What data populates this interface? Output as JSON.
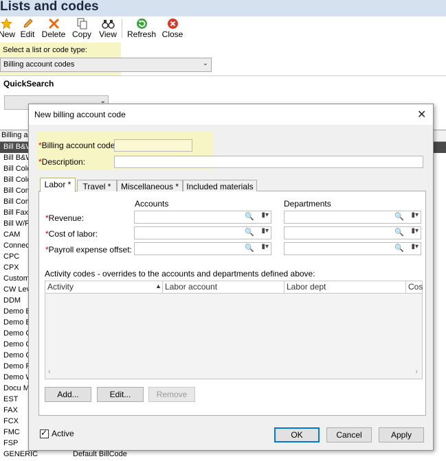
{
  "window": {
    "title": "Lists and codes"
  },
  "toolbar": {
    "buttons": [
      {
        "label": "New",
        "icon": "star-icon"
      },
      {
        "label": "Edit",
        "icon": "pencil-icon"
      },
      {
        "label": "Delete",
        "icon": "x-icon"
      },
      {
        "label": "Copy",
        "icon": "copy-icon"
      },
      {
        "label": "View",
        "icon": "binoculars-icon"
      },
      {
        "label": "Refresh",
        "icon": "refresh-icon"
      },
      {
        "label": "Close",
        "icon": "close-icon"
      }
    ]
  },
  "selector": {
    "label": "Select a list or code type:",
    "value": "Billing account codes"
  },
  "quicksearch": {
    "label": "QuickSearch"
  },
  "list": {
    "header": "Billing ac",
    "rows": [
      {
        "code": "Bill B&W",
        "desc": ""
      },
      {
        "code": "Bill B&W",
        "desc": ""
      },
      {
        "code": "Bill Colo",
        "desc": ""
      },
      {
        "code": "Bill Colo",
        "desc": ""
      },
      {
        "code": "Bill Com",
        "desc": ""
      },
      {
        "code": "Bill Com",
        "desc": ""
      },
      {
        "code": "Bill Fax",
        "desc": ""
      },
      {
        "code": "Bill W/F",
        "desc": ""
      },
      {
        "code": "CAM",
        "desc": ""
      },
      {
        "code": "Connec",
        "desc": ""
      },
      {
        "code": "CPC",
        "desc": ""
      },
      {
        "code": "CPX",
        "desc": ""
      },
      {
        "code": "Custom",
        "desc": ""
      },
      {
        "code": "CW Lev",
        "desc": ""
      },
      {
        "code": "DDM",
        "desc": ""
      },
      {
        "code": "Demo B",
        "desc": ""
      },
      {
        "code": "Demo B",
        "desc": ""
      },
      {
        "code": "Demo C",
        "desc": ""
      },
      {
        "code": "Demo C",
        "desc": ""
      },
      {
        "code": "Demo C",
        "desc": ""
      },
      {
        "code": "Demo F",
        "desc": ""
      },
      {
        "code": "Demo W",
        "desc": ""
      },
      {
        "code": "Docu M",
        "desc": ""
      },
      {
        "code": "EST",
        "desc": ""
      },
      {
        "code": "FAX",
        "desc": ""
      },
      {
        "code": "FCX",
        "desc": ""
      },
      {
        "code": "FMC",
        "desc": ""
      },
      {
        "code": "FSP",
        "desc": ""
      },
      {
        "code": "GENERIC",
        "desc": "Default BillCode"
      }
    ]
  },
  "dialog": {
    "title": "New billing account code",
    "close_glyph": "✕",
    "required_mark": "*",
    "fields": {
      "code_label": "Billing account code",
      "code_value": "",
      "desc_label": "Description:",
      "desc_value": ""
    },
    "tabs": [
      "Labor *",
      "Travel *",
      "Miscellaneous *",
      "Included materials"
    ],
    "labor": {
      "accounts_header": "Accounts",
      "departments_header": "Departments",
      "rows": [
        {
          "label": "Revenue:"
        },
        {
          "label": "Cost of labor:"
        },
        {
          "label": "Payroll expense offset:"
        }
      ],
      "activity_title": "Activity codes - overrides to the accounts and departments defined above:",
      "grid_columns": [
        "Activity",
        "Labor account",
        "Labor dept",
        "Cos"
      ],
      "buttons": {
        "add": "Add...",
        "edit": "Edit...",
        "remove": "Remove"
      }
    },
    "active": {
      "label": "Active",
      "checked": true
    },
    "footer": {
      "ok": "OK",
      "cancel": "Cancel",
      "apply": "Apply"
    }
  },
  "colors": {
    "highlight": "#f7f5c4",
    "required": "#d00000",
    "accent": "#0078d7"
  }
}
